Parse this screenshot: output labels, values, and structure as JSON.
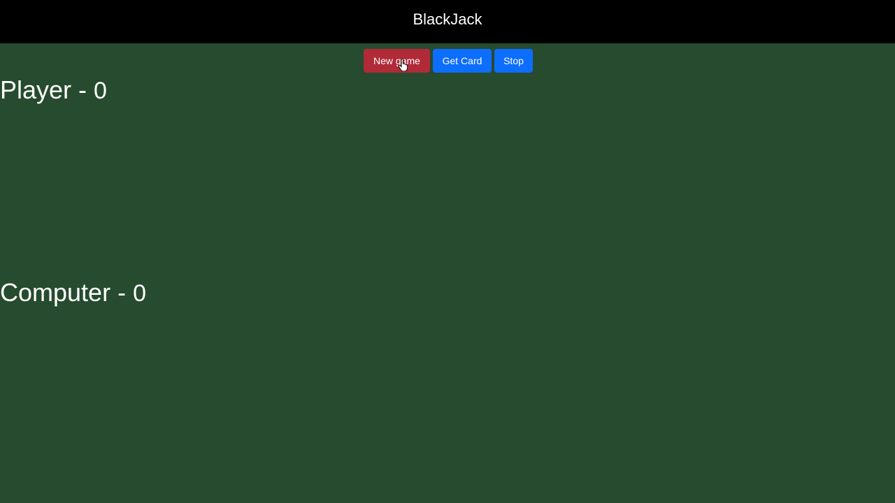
{
  "header": {
    "title": "BlackJack"
  },
  "controls": {
    "new_game_label": "New game",
    "get_card_label": "Get Card",
    "stop_label": "Stop"
  },
  "player": {
    "label": "Player -",
    "score": "0"
  },
  "computer": {
    "label": "Computer -",
    "score": "0"
  },
  "icons": {
    "cursor": "hand-pointer-icon"
  },
  "colors": {
    "table_felt": "#264b2e",
    "header_bg": "#000000",
    "danger": "#b02a37",
    "primary": "#0d6efd",
    "text": "#ffffff"
  }
}
